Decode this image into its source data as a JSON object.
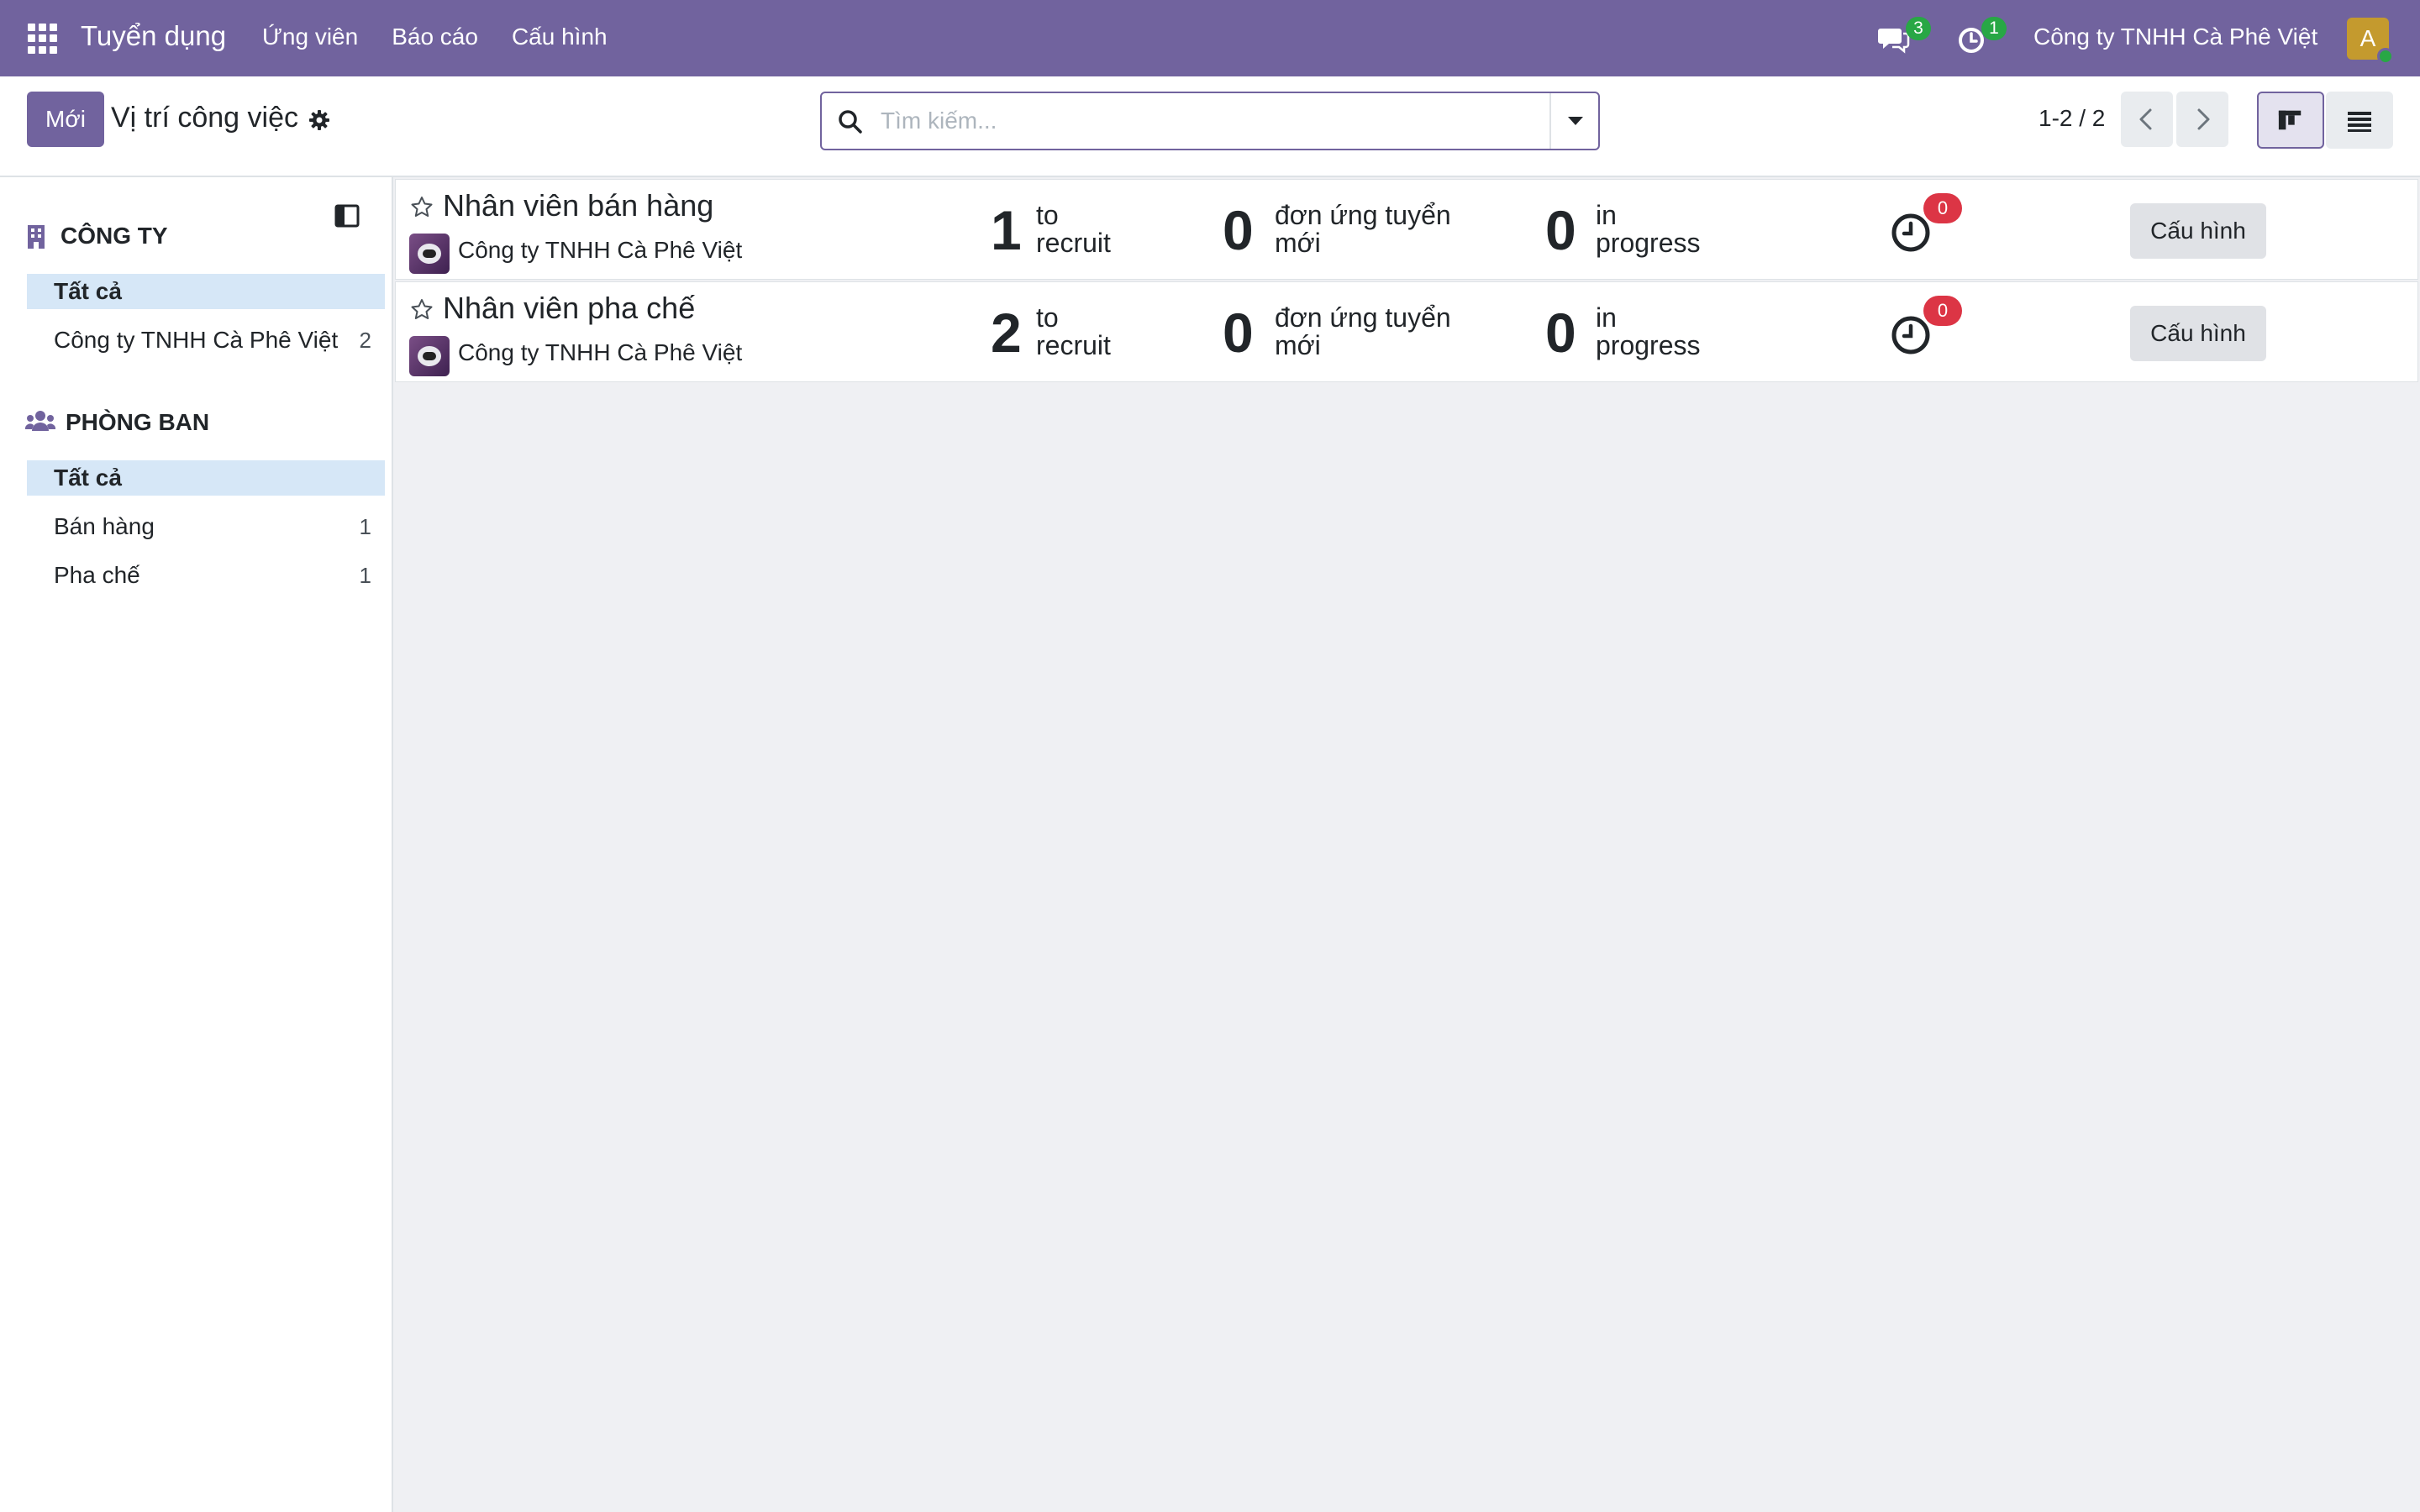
{
  "navbar": {
    "app_title": "Tuyển dụng",
    "menu": [
      "Ứng viên",
      "Báo cáo",
      "Cấu hình"
    ],
    "messages_count": "3",
    "activities_count": "1",
    "company": "Công ty TNHH Cà Phê Việt",
    "avatar_letter": "A",
    "brand_color": "#71639e"
  },
  "control_panel": {
    "new_button": "Mới",
    "title": "Vị trí công việc",
    "search_placeholder": "Tìm kiếm...",
    "pager": "1-2 / 2",
    "active_view": "kanban"
  },
  "sidebar": {
    "company_section": {
      "header": "CÔNG TY",
      "items": [
        {
          "label": "Tất cả",
          "count": "",
          "active": true
        },
        {
          "label": "Công ty TNHH Cà Phê Việt",
          "count": "2",
          "active": false
        }
      ]
    },
    "department_section": {
      "header": "PHÒNG BAN",
      "items": [
        {
          "label": "Tất cả",
          "count": "",
          "active": true
        },
        {
          "label": "Bán hàng",
          "count": "1",
          "active": false
        },
        {
          "label": "Pha chế",
          "count": "1",
          "active": false
        }
      ]
    }
  },
  "jobs": [
    {
      "title": "Nhân viên bán hàng",
      "company": "Công ty TNHH Cà Phê Việt",
      "to_recruit": "1",
      "to_recruit_label": [
        "to",
        "recruit"
      ],
      "new_applicants": "0",
      "new_applicants_label": [
        "đơn ứng tuyển",
        "mới"
      ],
      "in_progress": "0",
      "in_progress_label": [
        "in",
        "progress"
      ],
      "activities": "0",
      "config_button": "Cấu hình"
    },
    {
      "title": "Nhân viên pha chế",
      "company": "Công ty TNHH Cà Phê Việt",
      "to_recruit": "2",
      "to_recruit_label": [
        "to",
        "recruit"
      ],
      "new_applicants": "0",
      "new_applicants_label": [
        "đơn ứng tuyển",
        "mới"
      ],
      "in_progress": "0",
      "in_progress_label": [
        "in",
        "progress"
      ],
      "activities": "0",
      "config_button": "Cấu hình"
    }
  ]
}
